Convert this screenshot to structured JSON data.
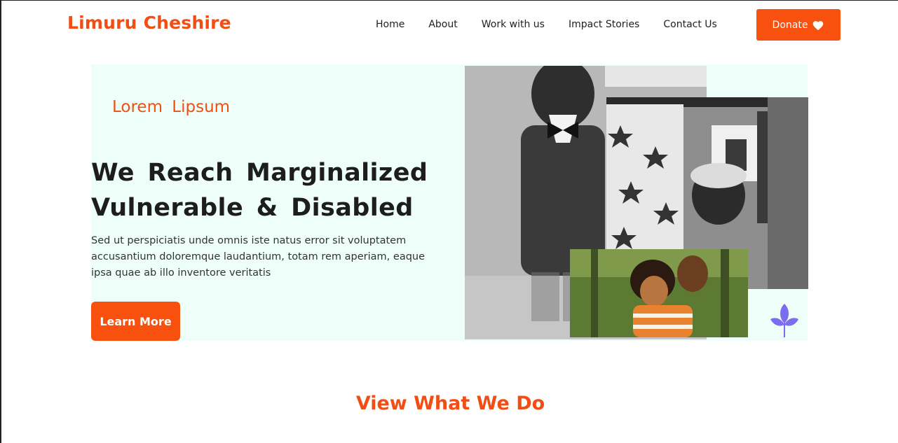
{
  "brand": "Limuru Cheshire",
  "nav": {
    "links": [
      "Home",
      "About",
      "Work with us",
      "Impact Stories",
      "Contact Us"
    ],
    "donate_label": "Donate"
  },
  "hero": {
    "eyebrow": "Lorem  Lipsum",
    "headline_line1": "We Reach Marginalized",
    "headline_line2": "Vulnerable & Disabled",
    "subtext": "Sed ut perspiciatis unde omnis iste natus error sit voluptatem accusantium doloremque laudantium, totam rem aperiam, eaque ipsa quae ab illo inventore veritatis",
    "cta_label": "Learn More"
  },
  "section": {
    "title": "View What We Do"
  },
  "colors": {
    "accent": "#f7500f",
    "brand_text": "#f04e14",
    "hero_bg": "#edfff8",
    "leaf": "#7b6cf0"
  },
  "icons": {
    "donate": "heart-icon",
    "decor": "leaf-icon"
  }
}
